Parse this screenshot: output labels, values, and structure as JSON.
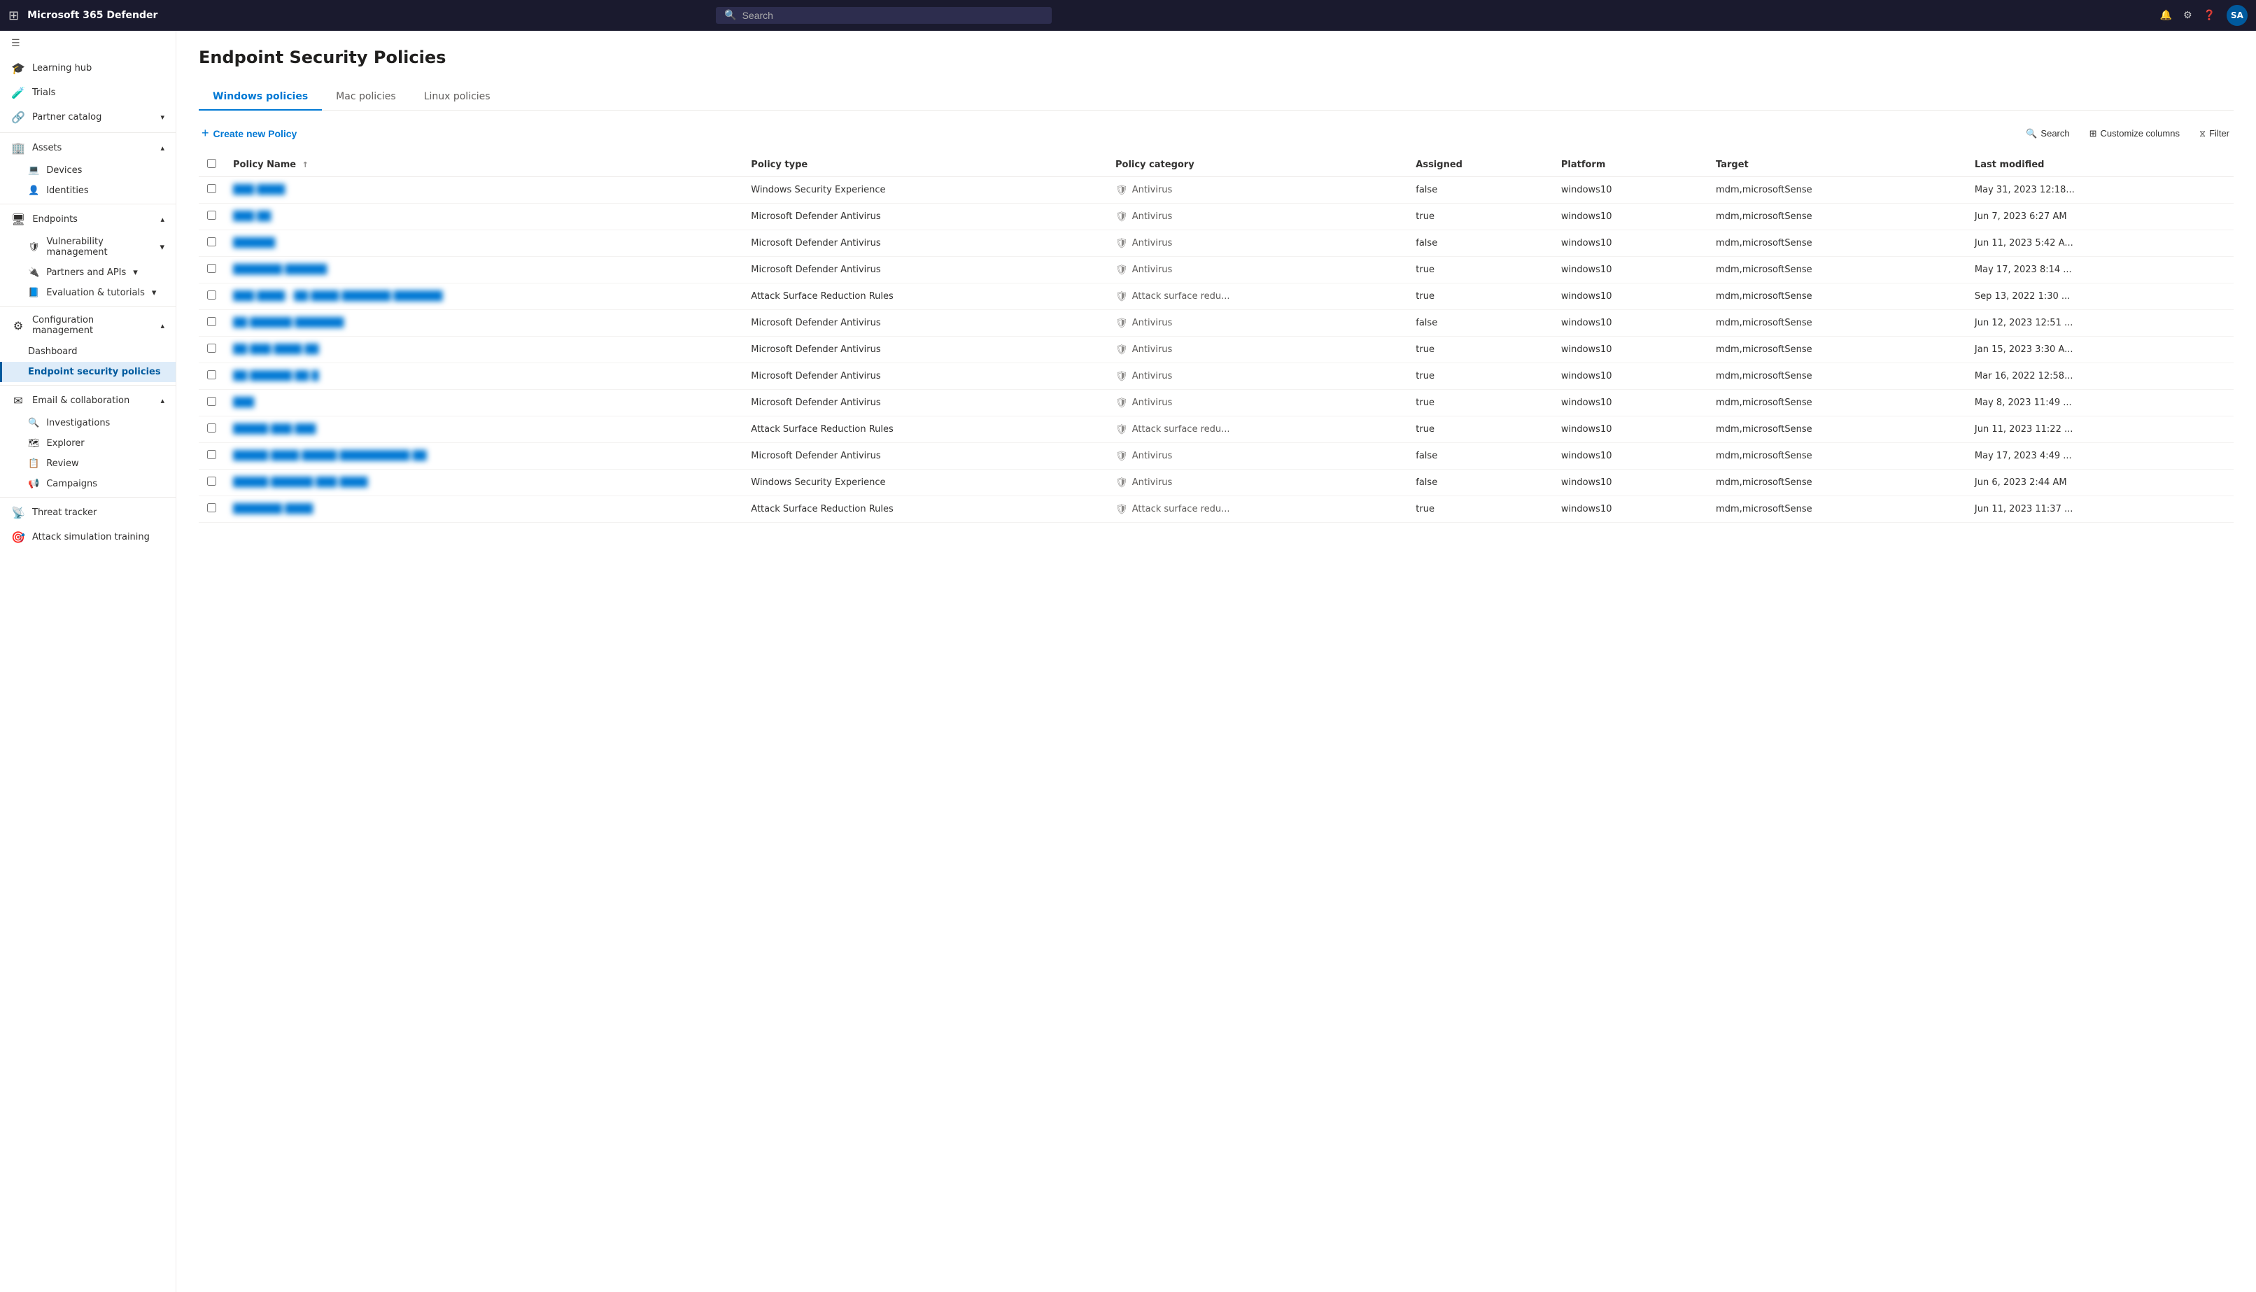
{
  "app": {
    "title": "Microsoft 365 Defender",
    "search_placeholder": "Search",
    "avatar_initials": "SA"
  },
  "sidebar": {
    "top_icon_label": "Collapse menu",
    "items": [
      {
        "id": "learning-hub",
        "icon": "🎓",
        "label": "Learning hub",
        "expandable": false
      },
      {
        "id": "trials",
        "icon": "🧪",
        "label": "Trials",
        "expandable": false
      },
      {
        "id": "partner-catalog",
        "icon": "🔗",
        "label": "Partner catalog",
        "expandable": true
      },
      {
        "id": "assets",
        "icon": "🏢",
        "label": "Assets",
        "expandable": true,
        "expanded": true
      },
      {
        "id": "devices",
        "icon": "💻",
        "label": "Devices",
        "child": true
      },
      {
        "id": "identities",
        "icon": "👤",
        "label": "Identities",
        "child": true
      },
      {
        "id": "endpoints",
        "icon": "🖥",
        "label": "Endpoints",
        "expandable": true,
        "expanded": true
      },
      {
        "id": "vulnerability-management",
        "icon": "🛡",
        "label": "Vulnerability management",
        "expandable": true,
        "child": true
      },
      {
        "id": "partners-and-apis",
        "icon": "🔌",
        "label": "Partners and APIs",
        "expandable": true,
        "child": true
      },
      {
        "id": "evaluation-tutorials",
        "icon": "📘",
        "label": "Evaluation & tutorials",
        "expandable": true,
        "child": true
      },
      {
        "id": "configuration-management",
        "icon": "⚙",
        "label": "Configuration management",
        "expandable": true,
        "child": true,
        "expanded": true
      },
      {
        "id": "dashboard",
        "icon": "",
        "label": "Dashboard",
        "deepchild": true
      },
      {
        "id": "endpoint-security-policies",
        "icon": "",
        "label": "Endpoint security policies",
        "deepchild": true,
        "active": true
      },
      {
        "id": "email-collaboration",
        "icon": "✉",
        "label": "Email & collaboration",
        "expandable": true,
        "expanded": true
      },
      {
        "id": "investigations",
        "icon": "🔍",
        "label": "Investigations",
        "child": true
      },
      {
        "id": "explorer",
        "icon": "🗺",
        "label": "Explorer",
        "child": true
      },
      {
        "id": "review",
        "icon": "📋",
        "label": "Review",
        "child": true
      },
      {
        "id": "campaigns",
        "icon": "📢",
        "label": "Campaigns",
        "child": true
      },
      {
        "id": "threat-tracker",
        "icon": "📡",
        "label": "Threat tracker"
      },
      {
        "id": "attack-simulation-training",
        "icon": "🎯",
        "label": "Attack simulation training"
      }
    ]
  },
  "page": {
    "title": "Endpoint Security Policies",
    "tabs": [
      {
        "id": "windows",
        "label": "Windows policies",
        "active": true
      },
      {
        "id": "mac",
        "label": "Mac policies",
        "active": false
      },
      {
        "id": "linux",
        "label": "Linux policies",
        "active": false
      }
    ],
    "toolbar": {
      "create_label": "Create new Policy",
      "search_label": "Search",
      "customize_label": "Customize columns",
      "filter_label": "Filter"
    },
    "table": {
      "columns": [
        {
          "id": "policy-name",
          "label": "Policy Name",
          "sortable": true
        },
        {
          "id": "policy-type",
          "label": "Policy type"
        },
        {
          "id": "policy-category",
          "label": "Policy category"
        },
        {
          "id": "assigned",
          "label": "Assigned"
        },
        {
          "id": "platform",
          "label": "Platform"
        },
        {
          "id": "target",
          "label": "Target"
        },
        {
          "id": "last-modified",
          "label": "Last modified"
        }
      ],
      "rows": [
        {
          "name": "███ ████",
          "blurred": true,
          "policy_type": "Windows Security Experience",
          "category": "Antivirus",
          "assigned": "false",
          "platform": "windows10",
          "target": "mdm,microsoftSense",
          "last_modified": "May 31, 2023 12:18..."
        },
        {
          "name": "███ ██",
          "blurred": true,
          "policy_type": "Microsoft Defender Antivirus",
          "category": "Antivirus",
          "assigned": "true",
          "platform": "windows10",
          "target": "mdm,microsoftSense",
          "last_modified": "Jun 7, 2023 6:27 AM"
        },
        {
          "name": "██████",
          "blurred": true,
          "policy_type": "Microsoft Defender Antivirus",
          "category": "Antivirus",
          "assigned": "false",
          "platform": "windows10",
          "target": "mdm,microsoftSense",
          "last_modified": "Jun 11, 2023 5:42 A..."
        },
        {
          "name": "███████ ██████",
          "blurred": true,
          "policy_type": "Microsoft Defender Antivirus",
          "category": "Antivirus",
          "assigned": "true",
          "platform": "windows10",
          "target": "mdm,microsoftSense",
          "last_modified": "May 17, 2023 8:14 ..."
        },
        {
          "name": "███ ████ - ██ ████ ███████ ███████",
          "blurred": true,
          "policy_type": "Attack Surface Reduction Rules",
          "category": "Attack surface redu...",
          "assigned": "true",
          "platform": "windows10",
          "target": "mdm,microsoftSense",
          "last_modified": "Sep 13, 2022 1:30 ..."
        },
        {
          "name": "██ ██████ ███████",
          "blurred": true,
          "policy_type": "Microsoft Defender Antivirus",
          "category": "Antivirus",
          "assigned": "false",
          "platform": "windows10",
          "target": "mdm,microsoftSense",
          "last_modified": "Jun 12, 2023 12:51 ..."
        },
        {
          "name": "██ ███ ████ ██",
          "blurred": true,
          "policy_type": "Microsoft Defender Antivirus",
          "category": "Antivirus",
          "assigned": "true",
          "platform": "windows10",
          "target": "mdm,microsoftSense",
          "last_modified": "Jan 15, 2023 3:30 A..."
        },
        {
          "name": "██ ██████ ██ █",
          "blurred": true,
          "policy_type": "Microsoft Defender Antivirus",
          "category": "Antivirus",
          "assigned": "true",
          "platform": "windows10",
          "target": "mdm,microsoftSense",
          "last_modified": "Mar 16, 2022 12:58..."
        },
        {
          "name": "███",
          "blurred": true,
          "policy_type": "Microsoft Defender Antivirus",
          "category": "Antivirus",
          "assigned": "true",
          "platform": "windows10",
          "target": "mdm,microsoftSense",
          "last_modified": "May 8, 2023 11:49 ..."
        },
        {
          "name": "█████ ███ ███",
          "blurred": true,
          "policy_type": "Attack Surface Reduction Rules",
          "category": "Attack surface redu...",
          "assigned": "true",
          "platform": "windows10",
          "target": "mdm,microsoftSense",
          "last_modified": "Jun 11, 2023 11:22 ..."
        },
        {
          "name": "█████ ████ █████ ██████████ ██",
          "blurred": true,
          "policy_type": "Microsoft Defender Antivirus",
          "category": "Antivirus",
          "assigned": "false",
          "platform": "windows10",
          "target": "mdm,microsoftSense",
          "last_modified": "May 17, 2023 4:49 ..."
        },
        {
          "name": "█████ ██████ ███ ████",
          "blurred": true,
          "policy_type": "Windows Security Experience",
          "category": "Antivirus",
          "assigned": "false",
          "platform": "windows10",
          "target": "mdm,microsoftSense",
          "last_modified": "Jun 6, 2023 2:44 AM"
        },
        {
          "name": "███████ ████",
          "blurred": true,
          "policy_type": "Attack Surface Reduction Rules",
          "category": "Attack surface redu...",
          "assigned": "true",
          "platform": "windows10",
          "target": "mdm,microsoftSense",
          "last_modified": "Jun 11, 2023 11:37 ..."
        }
      ]
    }
  }
}
